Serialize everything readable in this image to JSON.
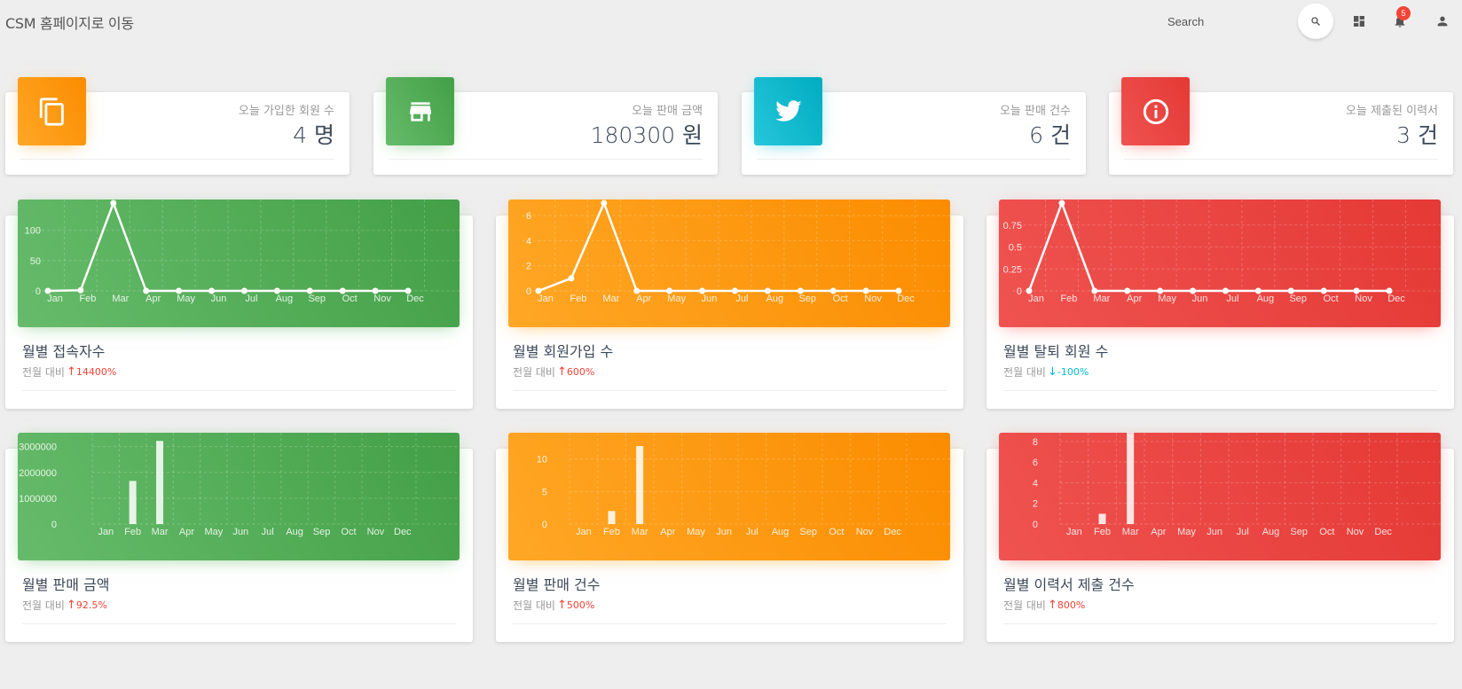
{
  "header": {
    "brand": "CSM 홈페이지로 이동",
    "search_placeholder": "Search",
    "notification_count": "5",
    "icons": [
      "search-icon",
      "dashboard-icon",
      "bell-icon",
      "person-icon"
    ]
  },
  "stats": [
    {
      "label": "오늘 가입한 회원 수",
      "value": "4 명",
      "icon": "copy-icon",
      "color": "#ff9800"
    },
    {
      "label": "오늘 판매 금액",
      "value": "180300 원",
      "icon": "store-icon",
      "color": "#4caf50"
    },
    {
      "label": "오늘 판매 건수",
      "value": "6 건",
      "icon": "twitter-icon",
      "color": "#00bcd4"
    },
    {
      "label": "오늘 제출된 이력서",
      "value": "3 건",
      "icon": "info-icon",
      "color": "#f44336"
    }
  ],
  "compare_label": "전월 대비",
  "charts": [
    {
      "title": "월별 접속자수",
      "trend": "up",
      "change": "14400%",
      "theme": "green"
    },
    {
      "title": "월별 회원가입 수",
      "trend": "up",
      "change": "600%",
      "theme": "orange"
    },
    {
      "title": "월별 탈퇴 회원 수",
      "trend": "down",
      "change": "-100%",
      "theme": "red"
    },
    {
      "title": "월별 판매 금액",
      "trend": "up",
      "change": "92.5%",
      "theme": "green"
    },
    {
      "title": "월별 판매 건수",
      "trend": "up",
      "change": "500%",
      "theme": "orange"
    },
    {
      "title": "월별 이력서 제출 건수",
      "trend": "up",
      "change": "800%",
      "theme": "red"
    }
  ],
  "chart_data": [
    {
      "type": "line",
      "categories": [
        "Jan",
        "Feb",
        "Mar",
        "Apr",
        "May",
        "Jun",
        "Jul",
        "Aug",
        "Sep",
        "Oct",
        "Nov",
        "Dec"
      ],
      "values": [
        0,
        1,
        145,
        0,
        0,
        0,
        0,
        0,
        0,
        0,
        0,
        0
      ],
      "ylim": [
        0,
        145
      ],
      "yticks": [
        "0",
        "50",
        "100"
      ],
      "ytick_values": [
        0,
        50,
        100
      ],
      "grid": true
    },
    {
      "type": "line",
      "categories": [
        "Jan",
        "Feb",
        "Mar",
        "Apr",
        "May",
        "Jun",
        "Jul",
        "Aug",
        "Sep",
        "Oct",
        "Nov",
        "Dec"
      ],
      "values": [
        0,
        1,
        7,
        0,
        0,
        0,
        0,
        0,
        0,
        0,
        0,
        0
      ],
      "ylim": [
        0,
        7
      ],
      "yticks": [
        "0",
        "2",
        "4",
        "6"
      ],
      "ytick_values": [
        0,
        2,
        4,
        6
      ],
      "grid": true
    },
    {
      "type": "line",
      "categories": [
        "Jan",
        "Feb",
        "Mar",
        "Apr",
        "May",
        "Jun",
        "Jul",
        "Aug",
        "Sep",
        "Oct",
        "Nov",
        "Dec"
      ],
      "values": [
        0,
        1,
        0,
        0,
        0,
        0,
        0,
        0,
        0,
        0,
        0,
        0
      ],
      "ylim": [
        0,
        1
      ],
      "yticks": [
        "0",
        "0.25",
        "0.5",
        "0.75"
      ],
      "ytick_values": [
        0,
        0.25,
        0.5,
        0.75
      ],
      "grid": true
    },
    {
      "type": "bar",
      "categories": [
        "Jan",
        "Feb",
        "Mar",
        "Apr",
        "May",
        "Jun",
        "Jul",
        "Aug",
        "Sep",
        "Oct",
        "Nov",
        "Dec"
      ],
      "values": [
        0,
        1670000,
        3220000,
        0,
        0,
        0,
        0,
        0,
        0,
        0,
        0,
        0
      ],
      "ylim": [
        0,
        3400000
      ],
      "yticks": [
        "0",
        "1000000",
        "2000000",
        "3000000"
      ],
      "ytick_values": [
        0,
        1000000,
        2000000,
        3000000
      ],
      "grid": true
    },
    {
      "type": "bar",
      "categories": [
        "Jan",
        "Feb",
        "Mar",
        "Apr",
        "May",
        "Jun",
        "Jul",
        "Aug",
        "Sep",
        "Oct",
        "Nov",
        "Dec"
      ],
      "values": [
        0,
        2,
        12,
        0,
        0,
        0,
        0,
        0,
        0,
        0,
        0,
        0
      ],
      "ylim": [
        0,
        13.5
      ],
      "yticks": [
        "0",
        "5",
        "10"
      ],
      "ytick_values": [
        0,
        5,
        10
      ],
      "grid": true
    },
    {
      "type": "bar",
      "categories": [
        "Jan",
        "Feb",
        "Mar",
        "Apr",
        "May",
        "Jun",
        "Jul",
        "Aug",
        "Sep",
        "Oct",
        "Nov",
        "Dec"
      ],
      "values": [
        0,
        1,
        9,
        0,
        0,
        0,
        0,
        0,
        0,
        0,
        0,
        0
      ],
      "ylim": [
        0,
        8.5
      ],
      "yticks": [
        "0",
        "2",
        "4",
        "6",
        "8"
      ],
      "ytick_values": [
        0,
        2,
        4,
        6,
        8
      ],
      "grid": true
    }
  ]
}
